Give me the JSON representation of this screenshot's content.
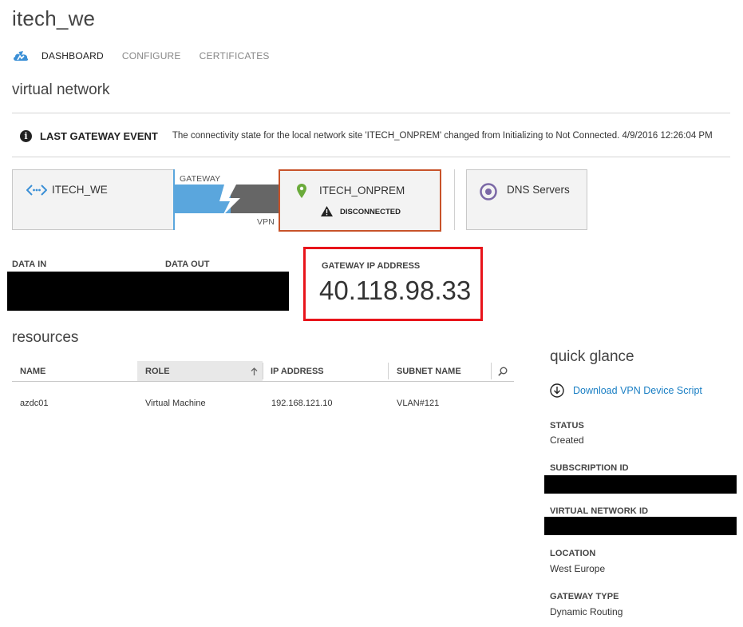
{
  "header": {
    "title": "itech_we"
  },
  "tabs": [
    {
      "label": "DASHBOARD",
      "active": true
    },
    {
      "label": "CONFIGURE",
      "active": false
    },
    {
      "label": "CERTIFICATES",
      "active": false
    }
  ],
  "section": {
    "title": "virtual network"
  },
  "event": {
    "label": "LAST GATEWAY EVENT",
    "message": "The connectivity state for the local network site 'ITECH_ONPREM' changed from Initializing to Not Connected. 4/9/2016 12:26:04 PM"
  },
  "diagram": {
    "virtual_network": "ITECH_WE",
    "gateway_label": "GATEWAY",
    "vpn_label": "VPN",
    "local_site": "ITECH_ONPREM",
    "local_status": "DISCONNECTED",
    "dns": "DNS Servers"
  },
  "stats": {
    "data_in_label": "DATA IN",
    "data_out_label": "DATA OUT",
    "gateway_ip_label": "GATEWAY IP ADDRESS",
    "gateway_ip": "40.118.98.33"
  },
  "resources": {
    "title": "resources",
    "columns": [
      "NAME",
      "ROLE",
      "IP ADDRESS",
      "SUBNET NAME"
    ],
    "rows": [
      {
        "name": "azdc01",
        "role": "Virtual Machine",
        "ip": "192.168.121.10",
        "subnet": "VLAN#121"
      }
    ]
  },
  "quick_glance": {
    "title": "quick glance",
    "download_link": "Download VPN Device Script",
    "status_label": "STATUS",
    "status": "Created",
    "subscription_label": "SUBSCRIPTION ID",
    "vnet_id_label": "VIRTUAL NETWORK ID",
    "location_label": "LOCATION",
    "location": "West Europe",
    "gateway_type_label": "GATEWAY TYPE",
    "gateway_type": "Dynamic Routing"
  },
  "colors": {
    "accent_blue": "#1a7fc4",
    "gateway_blue": "#5aa6dd",
    "alert_red": "#e8141b",
    "disconnected_border": "#c8532a",
    "pin_green": "#6aaa3a",
    "dns_purple": "#7b68a6"
  }
}
